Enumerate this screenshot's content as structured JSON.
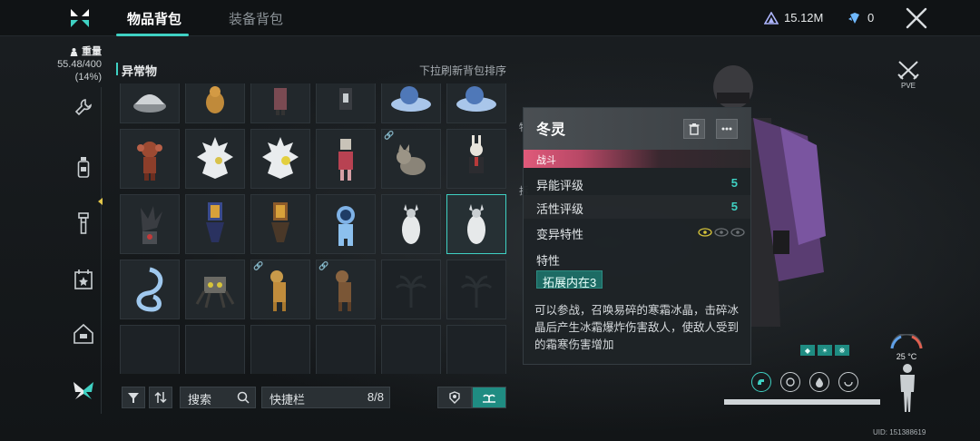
{
  "tabs": [
    {
      "label": "物品背包",
      "active": true
    },
    {
      "label": "装备背包",
      "active": false
    }
  ],
  "currency": {
    "energy_value": "15.12M",
    "crystal_value": "0"
  },
  "weight": {
    "label": "重量",
    "value": "55.48/400",
    "percent": "(14%)"
  },
  "inventory": {
    "category": "异常物",
    "refresh_hint": "下拉刷新背包排序"
  },
  "toolbar": {
    "search_label": "搜索",
    "quickbar_label": "快捷栏",
    "quickbar_count": "8/8"
  },
  "detail": {
    "name": "冬灵",
    "tag": "战斗",
    "rows": [
      {
        "key": "异能评级",
        "value": "5"
      },
      {
        "key": "活性评级",
        "value": "5"
      },
      {
        "key": "变异特性",
        "value": ""
      }
    ],
    "trait_label": "特性",
    "trait_chip": "拓展内在3",
    "description": "可以参战，召唤易碎的寒霜冰晶，击碎冰晶后产生冰霜爆炸伤害敌人，使敌人受到的霜寒伤害增加"
  },
  "status": {
    "mode": "PVE",
    "temperature": "25 °C",
    "stamina_fraction": 1.0,
    "uid": "UID: 151388619"
  },
  "side_hints": [
    "物",
    "拆"
  ],
  "colors": {
    "accent": "#3fd1c3",
    "tag_pink": "#e05a7a",
    "background": "#15191c"
  }
}
